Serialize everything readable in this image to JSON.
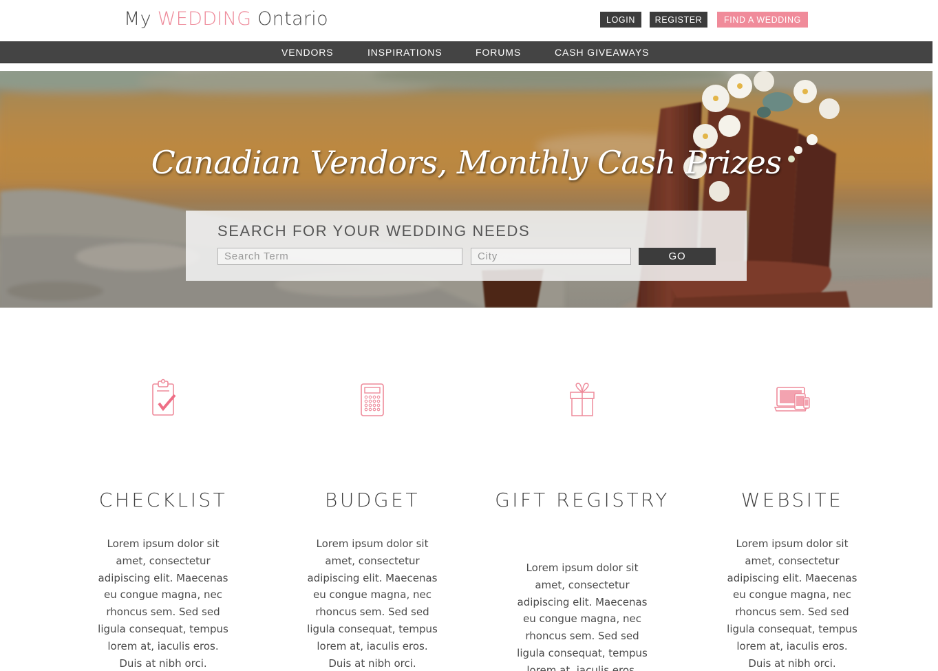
{
  "header": {
    "logo": {
      "part1": "My ",
      "part2": "WEDDING",
      "part3": " Ontario"
    },
    "buttons": {
      "login": "LOGIN",
      "register": "REGISTER",
      "find": "FIND A WEDDING"
    }
  },
  "nav": {
    "items": [
      {
        "label": "VENDORS"
      },
      {
        "label": "INSPIRATIONS"
      },
      {
        "label": "FORUMS"
      },
      {
        "label": "CASH GIVEAWAYS"
      }
    ]
  },
  "hero": {
    "title": "Canadian Vendors, Monthly Cash Prizes",
    "search": {
      "heading": "SEARCH FOR YOUR WEDDING NEEDS",
      "term_placeholder": "Search Term",
      "city_placeholder": "City",
      "go_label": "GO"
    }
  },
  "features": [
    {
      "icon": "clipboard-check-icon",
      "title": "CHECKLIST",
      "text": "Lorem ipsum dolor sit amet, consectetur adipiscing elit. Maecenas eu congue magna, nec rhoncus sem. Sed sed ligula consequat, tempus lorem at, iaculis eros. Duis at nibh orci. Vestibulum eu"
    },
    {
      "icon": "calculator-icon",
      "title": "BUDGET",
      "text": "Lorem ipsum dolor sit amet, consectetur adipiscing elit. Maecenas eu congue magna, nec rhoncus sem. Sed sed ligula consequat, tempus lorem at, iaculis eros. Duis at nibh orci. Vestibulum eu"
    },
    {
      "icon": "gift-icon",
      "title": "GIFT REGISTRY",
      "text": "Lorem ipsum dolor sit amet, consectetur adipiscing elit. Maecenas eu congue magna, nec rhoncus sem. Sed sed ligula consequat, tempus lorem at, iaculis eros. Duis"
    },
    {
      "icon": "devices-icon",
      "title": "WEBSITE",
      "text": "Lorem ipsum dolor sit amet, consectetur adipiscing elit. Maecenas eu congue magna, nec rhoncus sem. Sed sed ligula consequat, tempus lorem at, iaculis eros. Duis at nibh orci. Vestibulum eu"
    }
  ],
  "colors": {
    "accent": "#f08b9a",
    "dark": "#444444",
    "text": "#4a4a4a"
  }
}
